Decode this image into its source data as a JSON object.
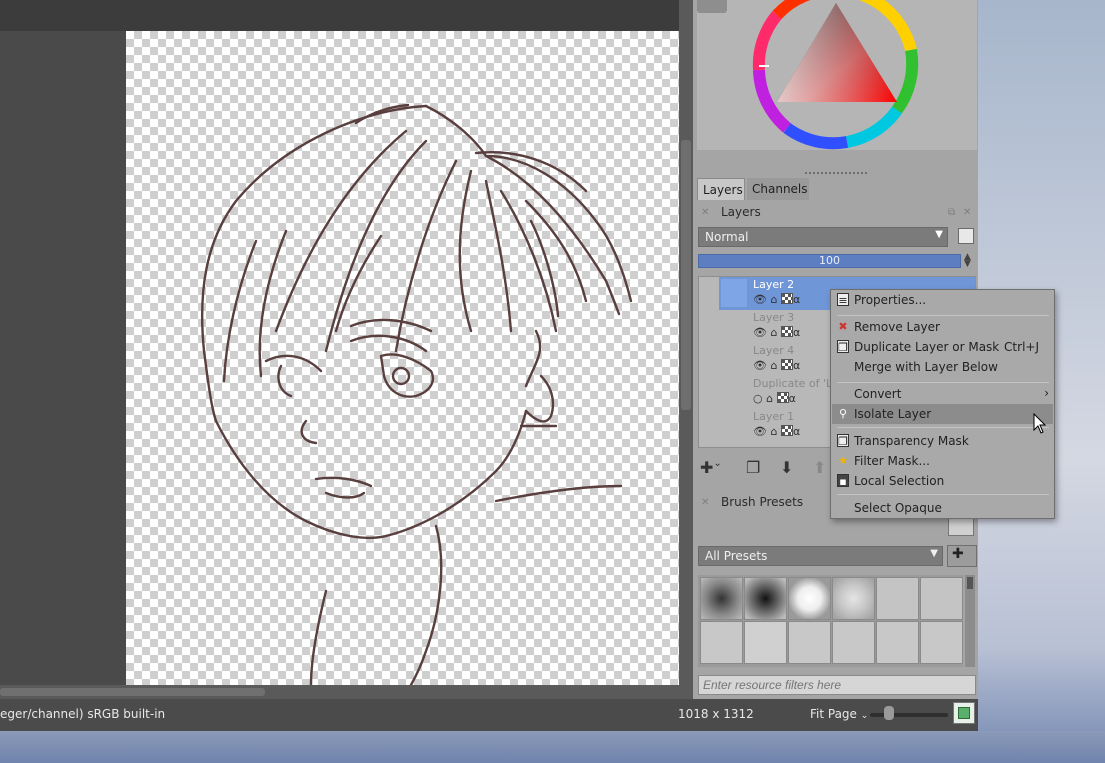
{
  "status_bar": {
    "color_info": "eger/channel)  sRGB built-in",
    "dimensions": "1018 x 1312",
    "zoom_mode": "Fit Page"
  },
  "layers_docker": {
    "tabs": [
      {
        "label": "Layers"
      },
      {
        "label": "Channels"
      }
    ],
    "panel_title": "Layers",
    "blend_mode": "Normal",
    "opacity": "100",
    "layers": [
      {
        "name": "Layer 2",
        "selected": true
      },
      {
        "name": "Layer 3",
        "selected": false
      },
      {
        "name": "Layer 4",
        "selected": false
      },
      {
        "name": "Duplicate of 'L",
        "selected": false
      },
      {
        "name": "Layer 1",
        "selected": false
      }
    ]
  },
  "brush_presets": {
    "panel_title": "Brush Presets",
    "filter": "All Presets",
    "resource_filter_placeholder": "Enter resource filters here"
  },
  "context_menu": {
    "items": [
      {
        "label": "Properties...",
        "icon": "properties-icon"
      },
      {
        "label": "Remove Layer",
        "icon": "remove-icon"
      },
      {
        "label": "Duplicate Layer or Mask",
        "icon": "duplicate-icon",
        "shortcut": "Ctrl+J"
      },
      {
        "label": "Merge with Layer Below"
      },
      {
        "label": "Convert",
        "submenu": true
      },
      {
        "label": "Isolate Layer",
        "icon": "isolate-icon",
        "hover": true
      },
      {
        "label": "Transparency Mask",
        "icon": "transparency-mask-icon"
      },
      {
        "label": "Filter Mask...",
        "icon": "filter-mask-icon"
      },
      {
        "label": "Local Selection",
        "icon": "local-selection-icon"
      },
      {
        "label": "Select Opaque"
      }
    ]
  },
  "colors": {
    "selection_blue": "#6f97d8",
    "canvas_dark": "#4a4a4a",
    "dock_gray": "#a5a5a5"
  }
}
